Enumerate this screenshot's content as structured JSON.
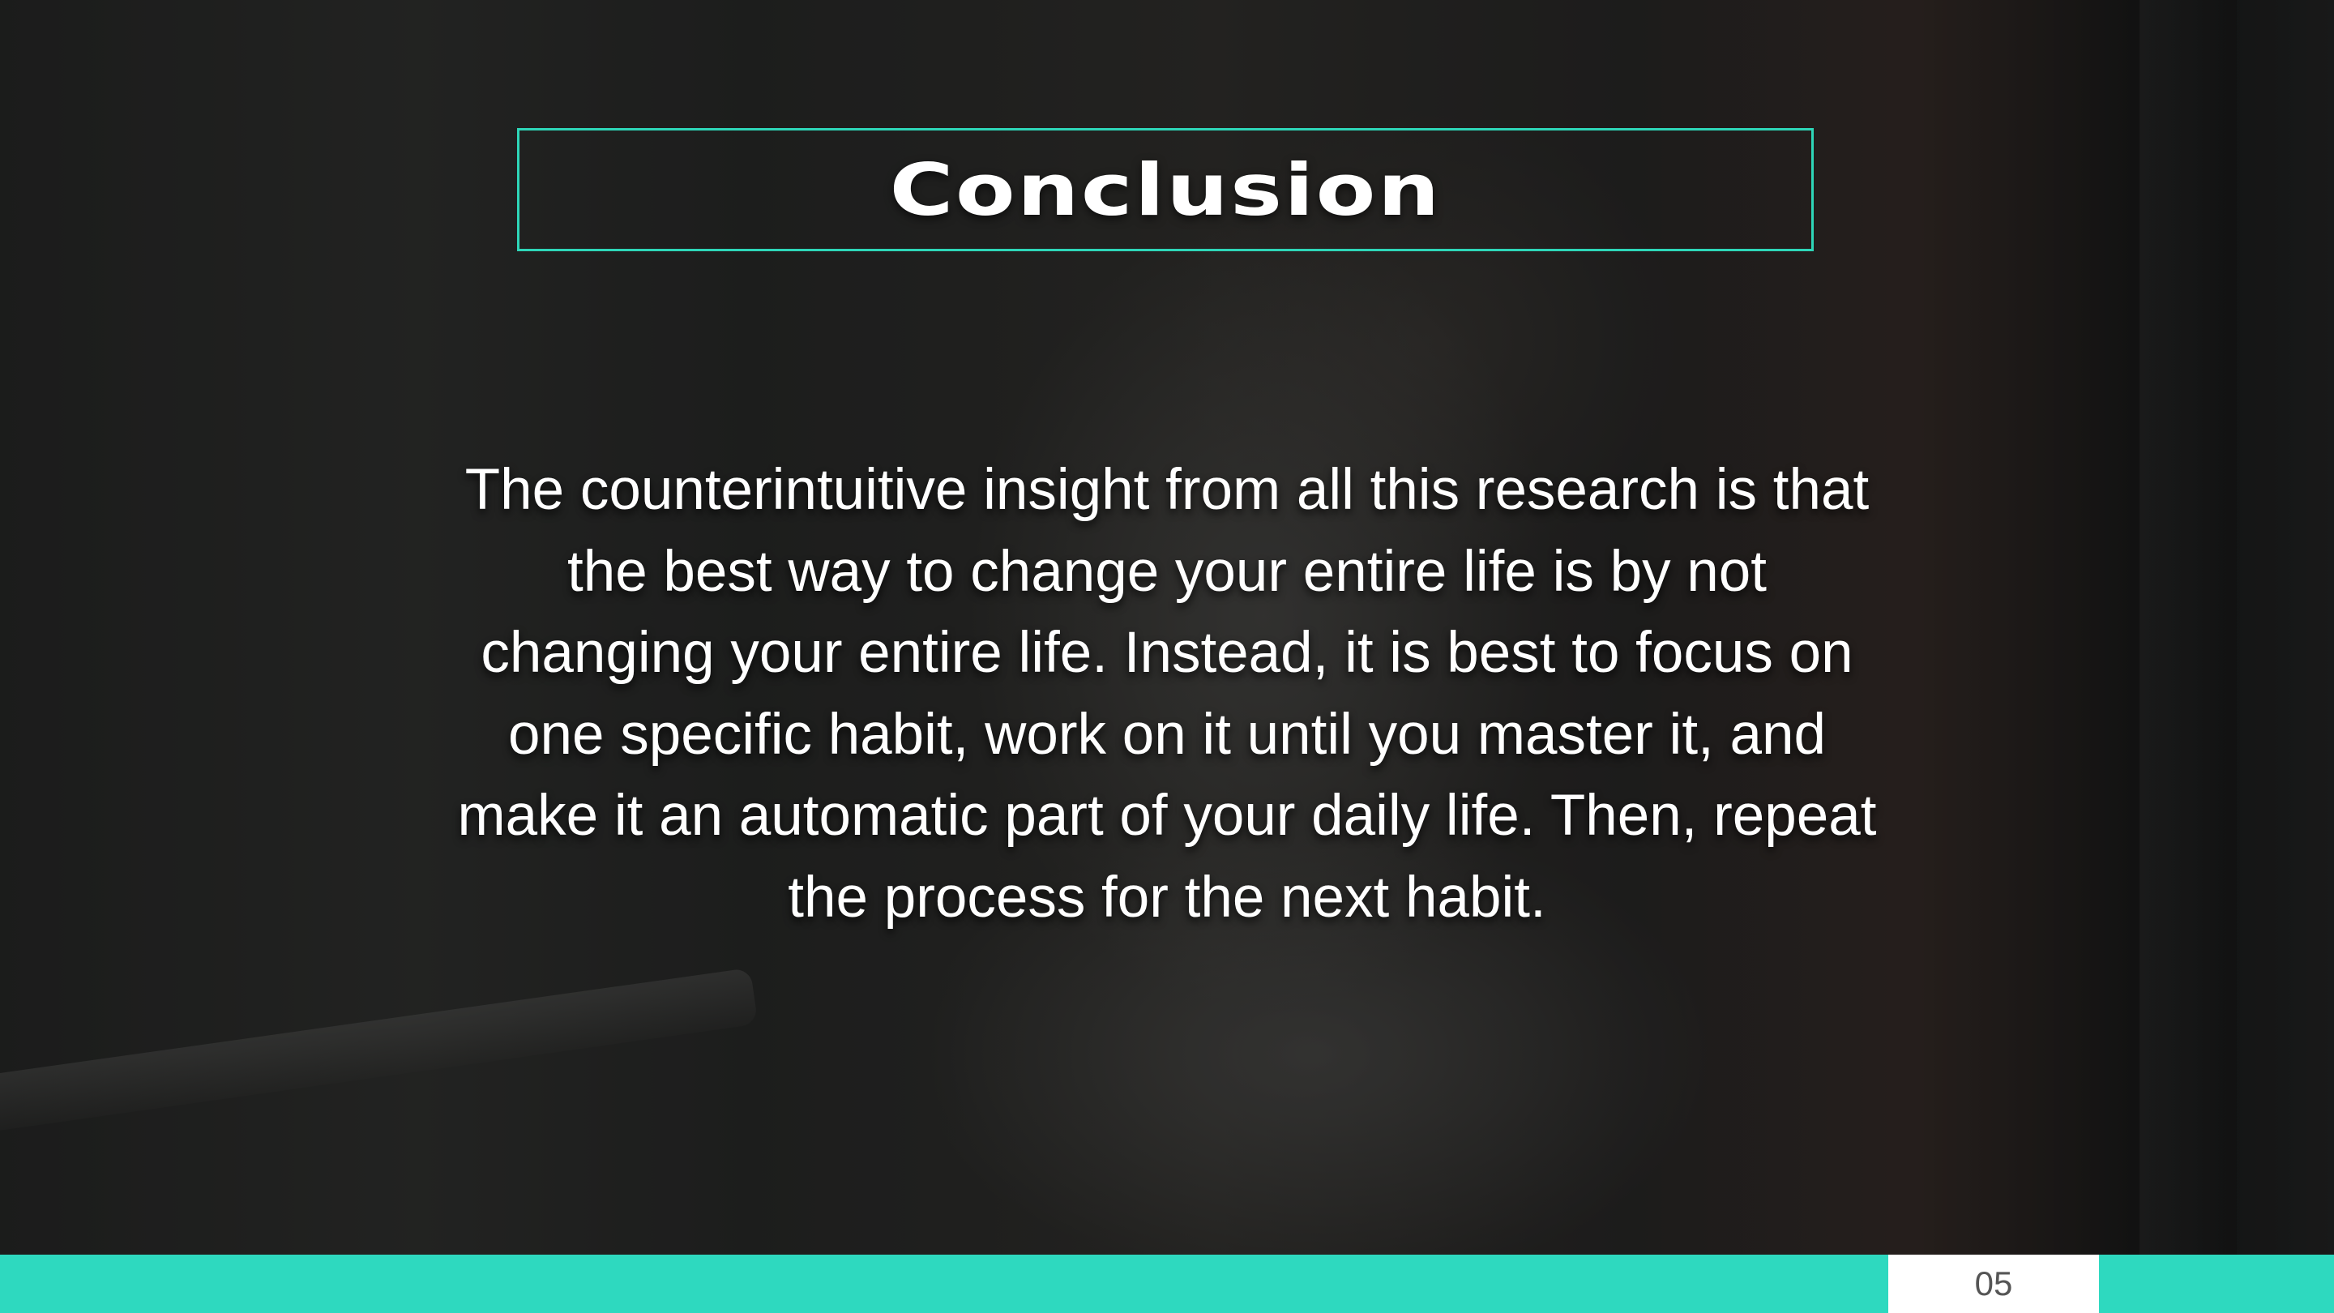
{
  "slide": {
    "title": "Conclusion",
    "body": "The counterintuitive insight from all this research is that the best way to change your entire life is by not changing your entire life. Instead, it is best to focus on one specific habit, work on it until you master it, and make it an automatic part of your daily life. Then, repeat the process for the next habit.",
    "page_number": "05"
  },
  "colors": {
    "accent": "#2ed9bf",
    "title_border": "#2ed6b8",
    "text": "#ffffff",
    "page_box": "#ffffff",
    "page_number_text": "#555555"
  }
}
